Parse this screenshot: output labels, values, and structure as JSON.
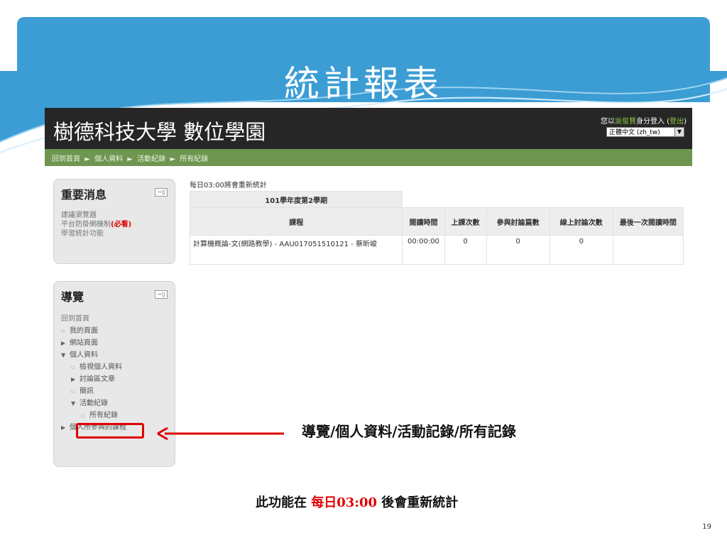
{
  "slide": {
    "title": "統計報表",
    "callout": "導覽/個人資料/活動記錄/所有記錄",
    "bottom_note": {
      "before": "此功能在 ",
      "highlight": "每日03:00",
      "after": " 後會重新統計"
    },
    "page_number": "19"
  },
  "header": {
    "site_title": "樹德科技大學 數位學園",
    "login": {
      "prefix": "您以",
      "name": "吳俊賢",
      "middle": "身分登入 (",
      "logout": "登出",
      "suffix": ")"
    },
    "language": "正體中文 (zh_tw)"
  },
  "breadcrumb": [
    "回到首頁",
    "►",
    "個人資料",
    "►",
    "活動紀錄",
    "►",
    "所有紀錄"
  ],
  "news_block": {
    "title": "重要消息",
    "items": [
      {
        "text": "建議瀏覽器"
      },
      {
        "text": "平台防掛網機制",
        "bold": "(必看)"
      },
      {
        "text": "學習統計功能"
      }
    ]
  },
  "nav_block": {
    "title": "導覽",
    "items": [
      {
        "label": "回到首頁",
        "level": 0,
        "marker": ""
      },
      {
        "label": "我的頁面",
        "level": 1,
        "marker": "▫"
      },
      {
        "label": "網站頁面",
        "level": 1,
        "marker": "▶"
      },
      {
        "label": "個人資料",
        "level": 1,
        "marker": "▼"
      },
      {
        "label": "檢視個人資料",
        "level": 2,
        "marker": "▫"
      },
      {
        "label": "討論區文章",
        "level": 2,
        "marker": "▶"
      },
      {
        "label": "簡訊",
        "level": 2,
        "marker": "▫"
      },
      {
        "label": "活動紀錄",
        "level": 2,
        "marker": "▼"
      },
      {
        "label": "所有紀錄",
        "level": 3,
        "marker": "▫"
      },
      {
        "label": "個人所參與的課程",
        "level": 1,
        "marker": "▶"
      }
    ]
  },
  "stats": {
    "note": "每日03:00將會重新統計",
    "term": "101學年度第2學期",
    "columns": [
      "課程",
      "閱讀時間",
      "上課次數",
      "參與討論篇數",
      "線上討論次數",
      "最後一次閱讀時間"
    ],
    "rows": [
      [
        "計算機概論-文(網路教學) - AAU017051510121 - 蔡昕峻",
        "00:00:00",
        "0",
        "0",
        "0",
        ""
      ]
    ]
  },
  "colors": {
    "banner": "#3c9dd5",
    "header_bg": "#262626",
    "navbar": "#6f9650",
    "highlight": "#e00000"
  }
}
